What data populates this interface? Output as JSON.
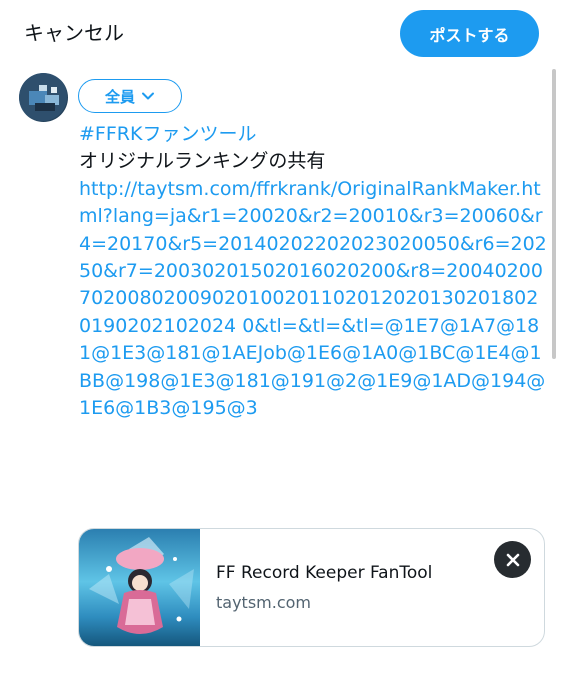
{
  "header": {
    "cancel_label": "キャンセル",
    "post_label": "ポストする"
  },
  "audience": {
    "label": "全員"
  },
  "tweet": {
    "hashtag": "#FFRKファンツール",
    "text": "オリジナルランキングの共有",
    "url": "http://taytsm.com/ffrkrank/OriginalRankMaker.html?lang=ja&r1=20020&r2=20010&r3=20060&r4=20170&r5=20140202202023020050&r6=20250&r7=20030201502016020200&r8=20040200702008020090201002011020120201302018020190202102024 0&tl=&tl=&tl=@1E7@1A7@181@1E3@181@1AEJob@1E6@1A0@1BC@1E4@1BB@198@1E3@181@191@2@1E9@1AD@194@1E6@1B3@195@3"
  },
  "card": {
    "title": "FF Record Keeper FanTool",
    "domain": "taytsm.com"
  },
  "colors": {
    "accent": "#1d9bf0",
    "text": "#0f1419",
    "muted": "#536471"
  }
}
